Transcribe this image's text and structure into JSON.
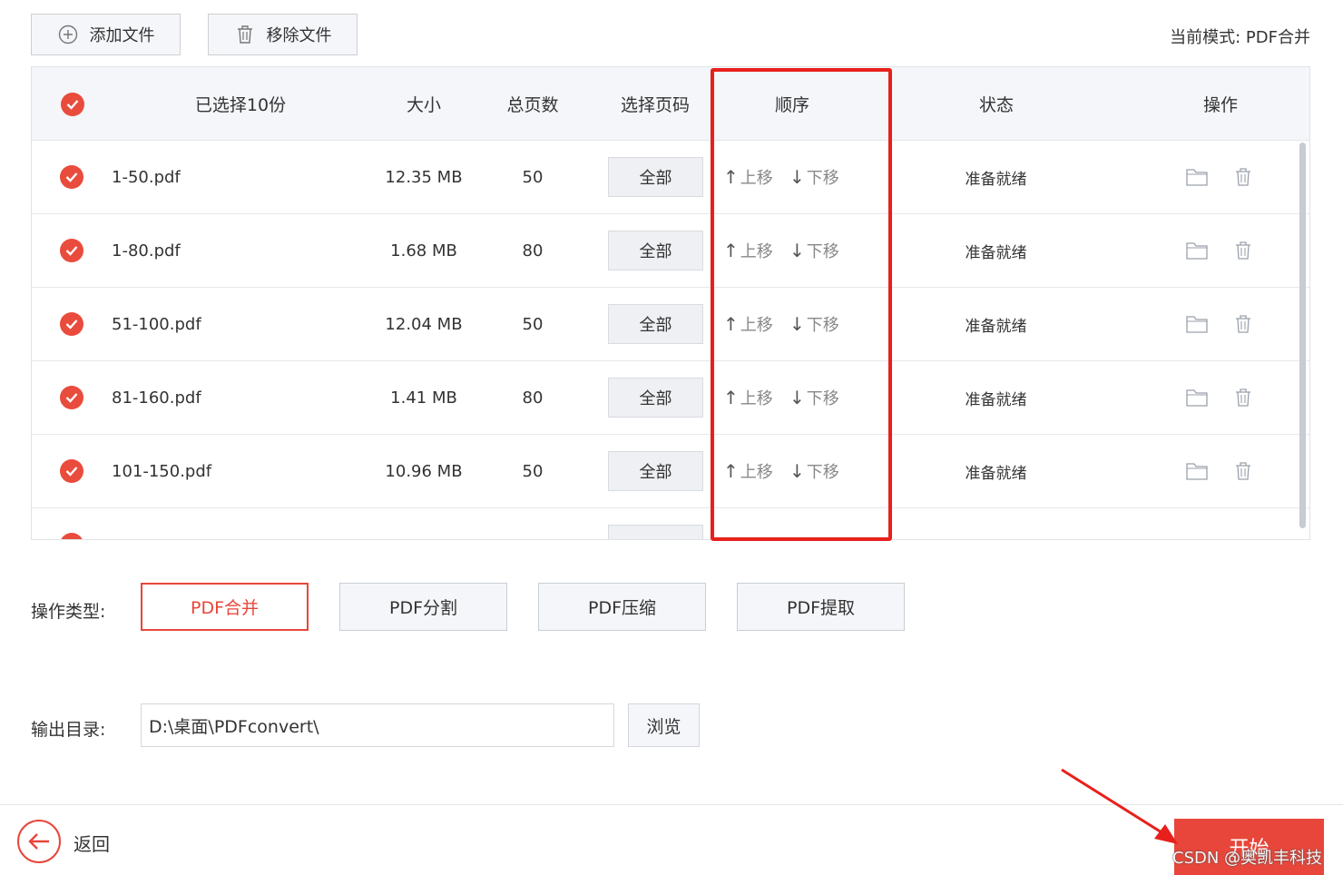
{
  "toolbar": {
    "add_label": "添加文件",
    "remove_label": "移除文件",
    "mode_label": "当前模式:",
    "mode_value": "PDF合并"
  },
  "table": {
    "headers": {
      "selected": "已选择10份",
      "size": "大小",
      "pages": "总页数",
      "page_select": "选择页码",
      "order": "顺序",
      "status": "状态",
      "action": "操作"
    },
    "rows": [
      {
        "name": "1-50.pdf",
        "size": "12.35 MB",
        "pages": "50",
        "page_btn": "全部",
        "up": "上移",
        "down": "下移",
        "status": "准备就绪"
      },
      {
        "name": "1-80.pdf",
        "size": "1.68 MB",
        "pages": "80",
        "page_btn": "全部",
        "up": "上移",
        "down": "下移",
        "status": "准备就绪"
      },
      {
        "name": "51-100.pdf",
        "size": "12.04 MB",
        "pages": "50",
        "page_btn": "全部",
        "up": "上移",
        "down": "下移",
        "status": "准备就绪"
      },
      {
        "name": "81-160.pdf",
        "size": "1.41 MB",
        "pages": "80",
        "page_btn": "全部",
        "up": "上移",
        "down": "下移",
        "status": "准备就绪"
      },
      {
        "name": "101-150.pdf",
        "size": "10.96 MB",
        "pages": "50",
        "page_btn": "全部",
        "up": "上移",
        "down": "下移",
        "status": "准备就绪"
      }
    ]
  },
  "op_type": {
    "label": "操作类型:",
    "options": [
      "PDF合并",
      "PDF分割",
      "PDF压缩",
      "PDF提取"
    ],
    "selected": "PDF合并"
  },
  "output": {
    "label": "输出目录:",
    "path": "D:\\桌面\\PDFconvert\\",
    "browse_label": "浏览"
  },
  "footer": {
    "back_label": "返回",
    "start_label": "开始",
    "watermark": "CSDN @奥凯丰科技"
  },
  "colors": {
    "accent": "#e8463a",
    "highlight_box": "#e8201b"
  }
}
